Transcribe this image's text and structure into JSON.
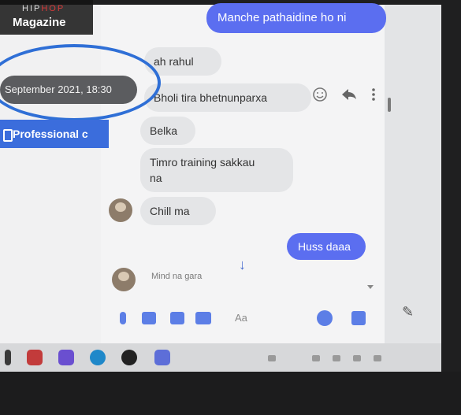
{
  "watermark": {
    "line1_a": "HIP",
    "line1_b": "HOP",
    "line2": "Magazine"
  },
  "date_label": "September 2021, 18:30",
  "professional_button": "Professional c",
  "messages": {
    "out_top": "Manche pathaidine ho ni",
    "in_1": "ah rahul",
    "in_2": "Bholi tira bhetnunparxa",
    "in_3": "Belka",
    "in_4_line1": "Timro training sakkau",
    "in_4_line2": "na",
    "in_5": "Chill ma",
    "out_bottom": "Huss daaa",
    "typing": "Mind na gara"
  },
  "composer": {
    "placeholder": "Aa"
  },
  "colors": {
    "accent": "#5b6ef0",
    "highlight": "#2f6fd6",
    "button": "#3b6ddc"
  },
  "icons": {
    "emoji": "smiley-icon",
    "reply": "reply-icon",
    "more": "more-vertical-icon",
    "scroll": "arrow-down-icon",
    "mic": "mic-icon",
    "image": "image-icon",
    "sticker": "sticker-icon",
    "gif": "gif-icon",
    "edit": "edit-icon"
  }
}
